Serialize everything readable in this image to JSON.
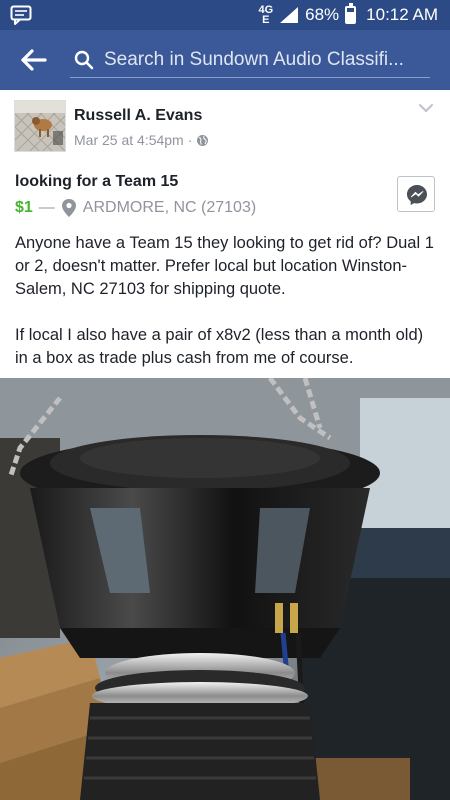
{
  "status_bar": {
    "network": "4G",
    "network_sub": "E",
    "battery_percent": "68%",
    "battery_level": 0.68,
    "time": "10:12 AM"
  },
  "app_bar": {
    "search_placeholder": "Search in Sundown Audio Classifi..."
  },
  "post": {
    "author": "Russell A. Evans",
    "timestamp": "Mar 25 at 4:54pm",
    "separator": "·",
    "listing_title": "looking for a Team 15",
    "price": "$1",
    "dash": "—",
    "location": "ARDMORE, NC (27103)",
    "body_paragraphs": [
      "Anyone have a Team 15 they looking to get rid of? Dual 1 or 2, doesn't matter.  Prefer local but location Winston-Salem, NC 27103 for shipping quote.",
      "If local I also have a pair of x8v2 (less than a month old) in a box as trade plus cash from me of course."
    ]
  },
  "colors": {
    "status_bar": "#2b4a86",
    "app_bar": "#3b5998",
    "price_green": "#42b72a",
    "meta_gray": "#90949c"
  },
  "icons": {
    "notification": "message-notification-icon",
    "back": "back-arrow-icon",
    "search": "search-icon",
    "privacy": "globe-icon",
    "menu": "chevron-down-icon",
    "location": "location-pin-icon",
    "message": "messenger-icon"
  }
}
